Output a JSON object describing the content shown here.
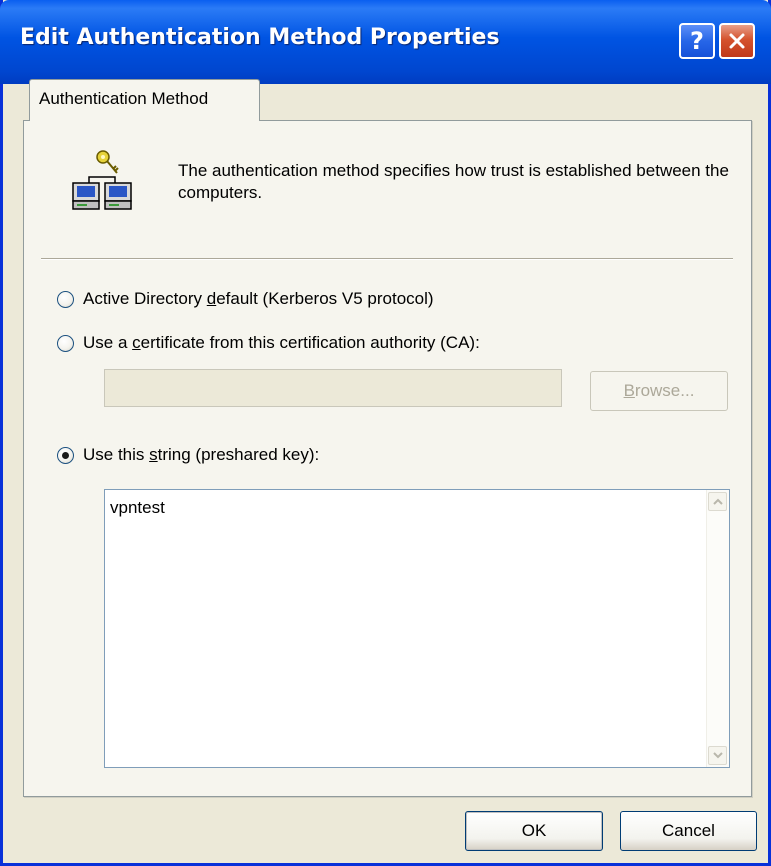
{
  "window": {
    "title": "Edit Authentication Method Properties",
    "help_glyph": "?",
    "colors": {
      "titlebar": "#0054e3",
      "close": "#d5532e",
      "face": "#ece9d8"
    }
  },
  "tabs": [
    {
      "label": "Authentication Method",
      "selected": true
    }
  ],
  "header": {
    "icon": "two-computers-key-icon",
    "description": "The authentication method specifies how trust is established between the computers."
  },
  "options": {
    "kerberos": {
      "pre": "Active Directory ",
      "key": "d",
      "post": "efault (Kerberos V5 protocol)",
      "checked": false
    },
    "certificate": {
      "pre": "Use a ",
      "key": "c",
      "post": "ertificate from this certification authority (CA):",
      "checked": false
    },
    "preshared": {
      "pre": "Use this ",
      "key": "s",
      "post": "tring (preshared key):",
      "checked": true
    }
  },
  "certificate_field": {
    "value": "",
    "enabled": false
  },
  "browse": {
    "pre": "",
    "key": "B",
    "post": "rowse...",
    "enabled": false
  },
  "preshared_key": {
    "value": "vpntest"
  },
  "buttons": {
    "ok": "OK",
    "cancel": "Cancel"
  }
}
